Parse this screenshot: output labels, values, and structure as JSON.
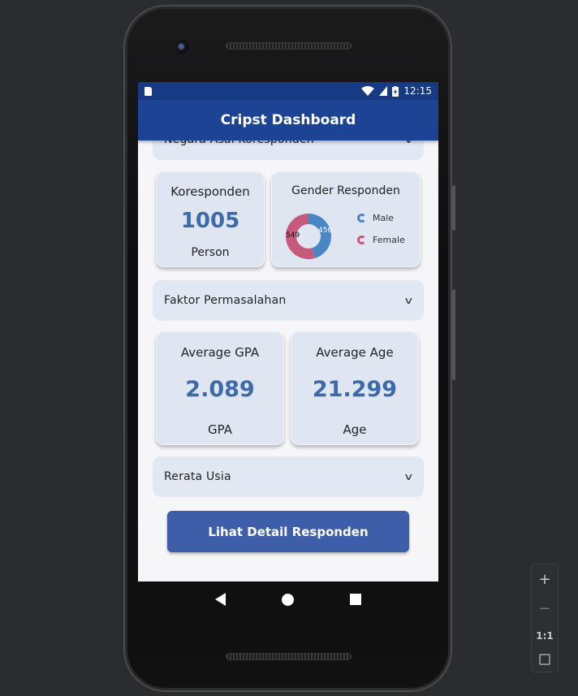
{
  "status_bar": {
    "time": "12:15"
  },
  "app_bar": {
    "title": "Cripst Dashboard"
  },
  "sections": {
    "negara_asal": "Negara Asal Koresponden",
    "faktor": "Faktor Permasalahan",
    "rerata_usia": "Rerata Usia"
  },
  "koresponden_card": {
    "title": "Koresponden",
    "value": "1005",
    "unit": "Person"
  },
  "gender_card": {
    "title": "Gender Responden",
    "legend": [
      {
        "label": "Male",
        "color": "#4a86c5"
      },
      {
        "label": "Female",
        "color": "#c65a7b"
      }
    ],
    "labels": {
      "male_value": "456",
      "female_value": "549"
    }
  },
  "chart_data": {
    "type": "pie",
    "title": "Gender Responden",
    "categories": [
      "Male",
      "Female"
    ],
    "values": [
      456,
      549
    ],
    "colors": [
      "#4a86c5",
      "#c65a7b"
    ],
    "donut": true
  },
  "gpa_card": {
    "title": "Average GPA",
    "value": "2.089",
    "unit": "GPA"
  },
  "age_card": {
    "title": "Average Age",
    "value": "21.299",
    "unit": "Age"
  },
  "detail_button": {
    "label": "Lihat Detail Responden"
  },
  "zoom_controls": {
    "plus": "+",
    "minus": "−",
    "one_to_one": "1:1"
  },
  "icons": {
    "wifi": "wifi-icon",
    "signal": "signal-icon",
    "battery": "battery-icon",
    "chevron": "chevron-down-icon",
    "back": "back-icon",
    "home": "home-icon",
    "recent": "recent-apps-icon"
  }
}
